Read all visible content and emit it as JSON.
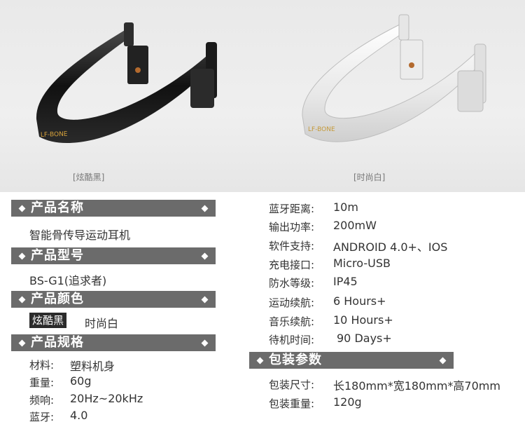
{
  "captions": {
    "black": "[炫酷黑]",
    "white": "[时尚白]"
  },
  "brand_logo": "LF-BONE",
  "sections": {
    "name": {
      "title": "产品名称",
      "value": "智能骨传导运动耳机"
    },
    "model": {
      "title": "产品型号",
      "value": "BS-G1(追求者)"
    },
    "color": {
      "title": "产品颜色",
      "options": [
        "炫酷黑",
        "时尚白"
      ],
      "selected": "炫酷黑"
    },
    "spec": {
      "title": "产品规格",
      "rows": [
        {
          "label": "材料:",
          "value": "塑料机身"
        },
        {
          "label": "重量:",
          "value": "60g"
        },
        {
          "label": "频响:",
          "value": "20Hz~20kHz"
        },
        {
          "label": "蓝牙:",
          "value": "4.0"
        }
      ]
    },
    "right_specs": [
      {
        "label": "蓝牙距离:",
        "value": "10m"
      },
      {
        "label": "输出功率:",
        "value": "200mW"
      },
      {
        "label": "软件支持:",
        "value": "ANDROID 4.0+、IOS"
      },
      {
        "label": "充电接口:",
        "value": "Micro-USB"
      },
      {
        "label": "防水等级:",
        "value": "IP45"
      },
      {
        "label": "运动续航:",
        "value": "6 Hours+"
      },
      {
        "label": "音乐续航:",
        "value": "10 Hours+"
      },
      {
        "label": "待机时间:",
        "value": "90 Days+"
      }
    ],
    "package": {
      "title": "包装参数",
      "rows": [
        {
          "label": "包装尺寸:",
          "value": "长180mm*宽180mm*高70mm"
        },
        {
          "label": "包装重量:",
          "value": "120g"
        }
      ]
    }
  },
  "colors": {
    "bar": "#6b6b6b",
    "black_product": "#1c1c1c",
    "white_product": "#f4f4f4"
  }
}
